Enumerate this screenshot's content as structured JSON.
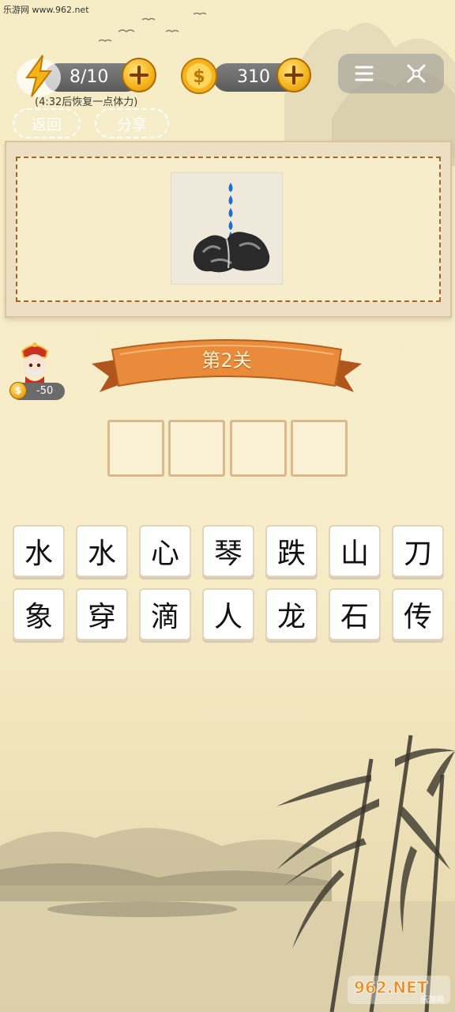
{
  "watermark_top": "乐游网 www.962.net",
  "status": {
    "energy": "8/10",
    "coins": "310",
    "recover_text": "(4:32后恢复一点体力)"
  },
  "buttons": {
    "back": "返回",
    "share": "分享"
  },
  "level": {
    "title": "第2关",
    "hint_cost": "-50"
  },
  "answer_slots": 4,
  "tiles_row1": [
    "水",
    "水",
    "心",
    "琴",
    "跌",
    "山",
    "刀"
  ],
  "tiles_row2": [
    "象",
    "穿",
    "滴",
    "人",
    "龙",
    "石",
    "传"
  ],
  "icons": {
    "energy": "lightning-icon",
    "coin": "coin-icon",
    "plus": "plus-icon",
    "menu": "menu-icon",
    "close": "close-icon",
    "avatar": "character-avatar"
  },
  "watermark_bottom": {
    "brand": "962.NET",
    "sub": "乐游网"
  },
  "colors": {
    "accent_gold": "#f4b21c",
    "ribbon": "#e98b3a",
    "board_border": "#a0662e"
  }
}
